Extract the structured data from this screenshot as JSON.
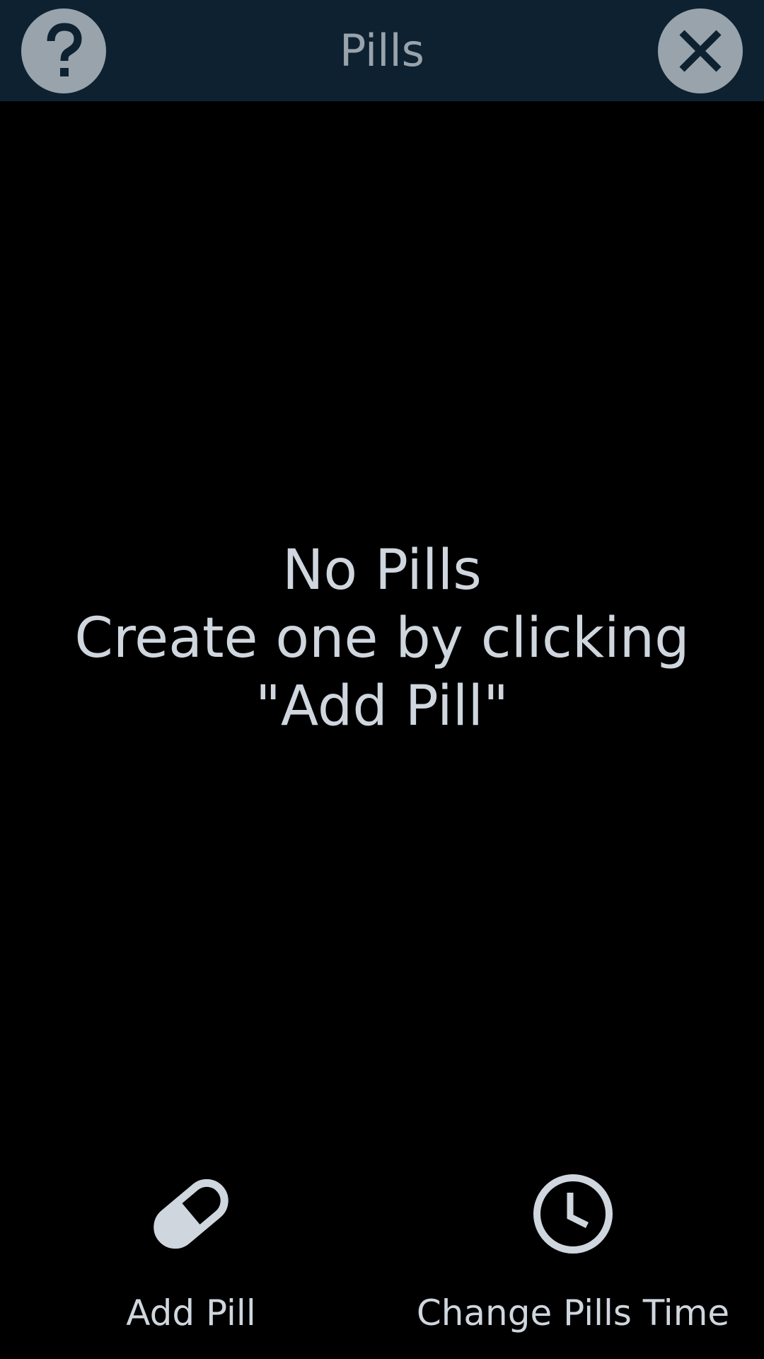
{
  "header": {
    "title": "Pills",
    "help_icon": "question-mark-icon",
    "close_icon": "close-icon"
  },
  "empty_state": {
    "line1": "No Pills",
    "line2": "Create one by clicking",
    "line3": "\"Add Pill\""
  },
  "actions": {
    "add_pill": {
      "label": "Add Pill",
      "icon": "pill-icon"
    },
    "change_time": {
      "label": "Change Pills Time",
      "icon": "clock-icon"
    }
  },
  "colors": {
    "topbar": "#0e2130",
    "button_fill": "#98a3ac",
    "text": "#cfd6de",
    "background": "#000000"
  }
}
